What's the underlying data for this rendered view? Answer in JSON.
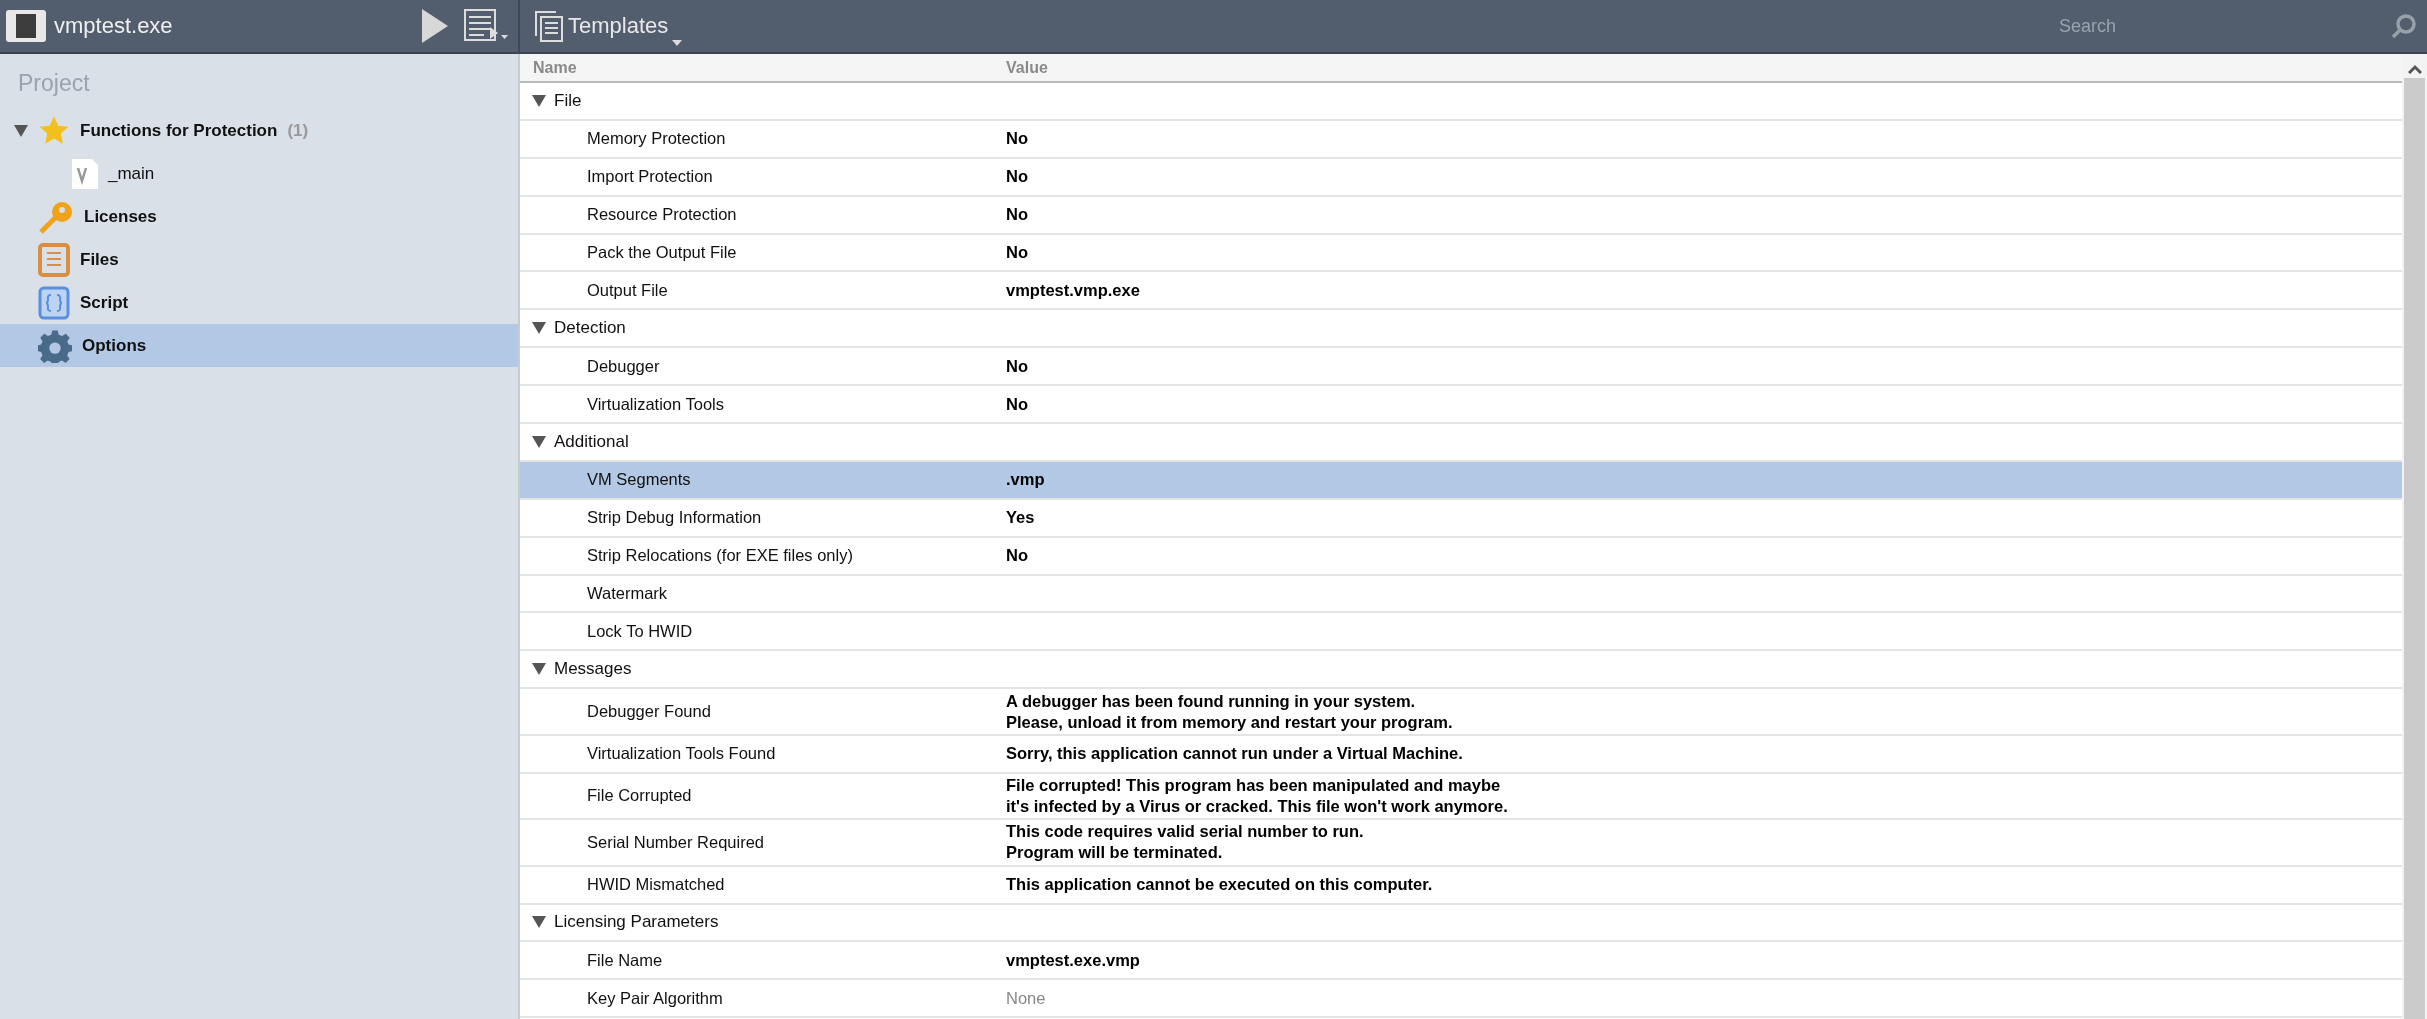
{
  "toolbar": {
    "file_title": "vmptest.exe",
    "templates_label": "Templates",
    "search": {
      "placeholder": "Search"
    }
  },
  "sidebar": {
    "title": "Project",
    "items": [
      {
        "label": "Functions for Protection",
        "count": "(1)",
        "kind": "star",
        "expanded": true,
        "selected": false,
        "children": [
          {
            "label": "_main",
            "kind": "function",
            "selected": false
          }
        ]
      },
      {
        "label": "Licenses",
        "kind": "key",
        "selected": false
      },
      {
        "label": "Files",
        "kind": "files",
        "selected": false
      },
      {
        "label": "Script",
        "kind": "script",
        "selected": false
      },
      {
        "label": "Options",
        "kind": "gear",
        "selected": true
      }
    ]
  },
  "table": {
    "columns": [
      "Name",
      "Value"
    ],
    "sections": [
      {
        "title": "File",
        "expanded": true,
        "rows": [
          {
            "name": "Memory Protection",
            "value": [
              "No"
            ],
            "kind": "set",
            "selected": false
          },
          {
            "name": "Import Protection",
            "value": [
              "No"
            ],
            "kind": "set",
            "selected": false
          },
          {
            "name": "Resource Protection",
            "value": [
              "No"
            ],
            "kind": "set",
            "selected": false
          },
          {
            "name": "Pack the Output File",
            "value": [
              "No"
            ],
            "kind": "set",
            "selected": false
          },
          {
            "name": "Output File",
            "value": [
              "vmptest.vmp.exe"
            ],
            "kind": "set",
            "selected": false
          }
        ]
      },
      {
        "title": "Detection",
        "expanded": true,
        "rows": [
          {
            "name": "Debugger",
            "value": [
              "No"
            ],
            "kind": "set",
            "selected": false
          },
          {
            "name": "Virtualization Tools",
            "value": [
              "No"
            ],
            "kind": "set",
            "selected": false
          }
        ]
      },
      {
        "title": "Additional",
        "expanded": true,
        "rows": [
          {
            "name": "VM Segments",
            "value": [
              ".vmp"
            ],
            "kind": "set",
            "selected": true
          },
          {
            "name": "Strip Debug Information",
            "value": [
              "Yes"
            ],
            "kind": "set",
            "selected": false
          },
          {
            "name": "Strip Relocations (for EXE files only)",
            "value": [
              "No"
            ],
            "kind": "set",
            "selected": false
          },
          {
            "name": "Watermark",
            "kind": "set",
            "selected": false
          },
          {
            "name": "Lock To HWID",
            "kind": "set",
            "selected": false
          }
        ]
      },
      {
        "title": "Messages",
        "expanded": true,
        "rows": [
          {
            "name": "Debugger Found",
            "value": [
              "A debugger has been found running in your system.",
              "Please, unload it from memory and restart your program."
            ],
            "kind": "set",
            "selected": false
          },
          {
            "name": "Virtualization Tools Found",
            "value": [
              "Sorry, this application cannot run under a Virtual Machine."
            ],
            "kind": "set",
            "selected": false
          },
          {
            "name": "File Corrupted",
            "value": [
              "File corrupted! This program has been manipulated and maybe",
              "it's infected by a Virus or cracked. This file won't work anymore."
            ],
            "kind": "set",
            "selected": false
          },
          {
            "name": "Serial Number Required",
            "value": [
              "This code requires valid serial number to run.",
              "Program will be terminated."
            ],
            "kind": "set",
            "selected": false
          },
          {
            "name": "HWID Mismatched",
            "value": [
              "This application cannot be executed on this computer."
            ],
            "kind": "set",
            "selected": false
          }
        ]
      },
      {
        "title": "Licensing Parameters",
        "expanded": true,
        "rows": [
          {
            "name": "File Name",
            "value": [
              "vmptest.exe.vmp"
            ],
            "kind": "set",
            "selected": false
          },
          {
            "name": "Key Pair Algorithm",
            "value": [
              "None"
            ],
            "kind": "default",
            "selected": false
          }
        ]
      }
    ]
  }
}
